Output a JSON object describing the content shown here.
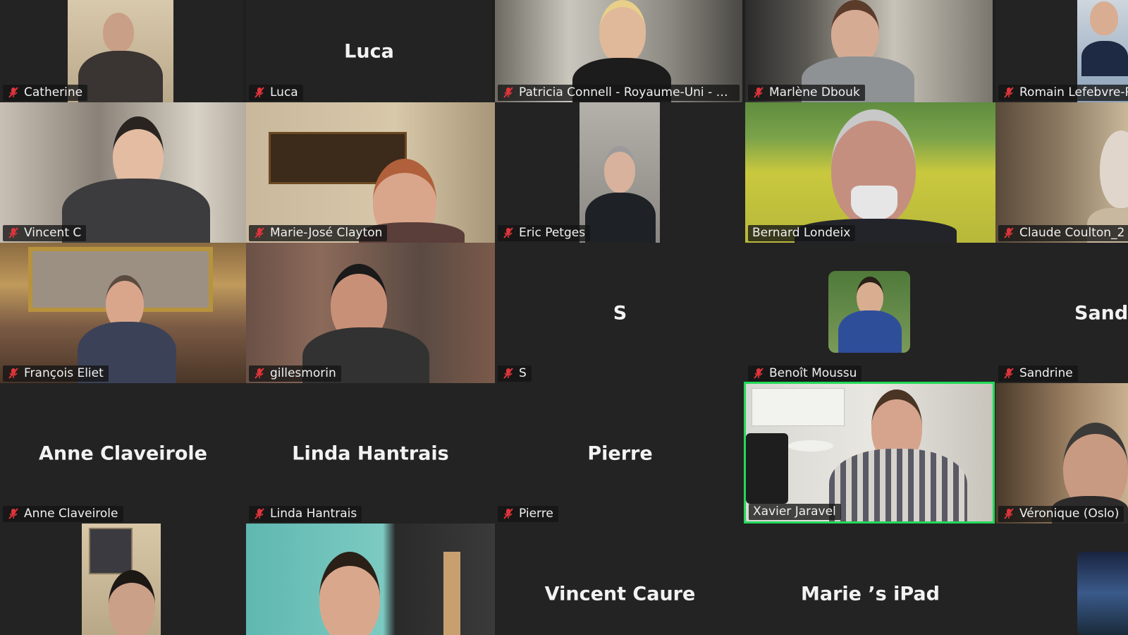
{
  "app": "Video conference — gallery view",
  "participants": [
    {
      "name": "Catherine",
      "center": "",
      "muted": true,
      "video": true,
      "active": false
    },
    {
      "name": "Luca",
      "center": "Luca",
      "muted": true,
      "video": false,
      "active": false
    },
    {
      "name": "Patricia Connell  - Royaume-Uni - Co...",
      "center": "",
      "muted": true,
      "video": true,
      "active": false
    },
    {
      "name": "Marlène Dbouk",
      "center": "",
      "muted": true,
      "video": true,
      "active": false
    },
    {
      "name": "Romain Lefebvre-R",
      "center": "",
      "muted": true,
      "video": true,
      "active": false
    },
    {
      "name": "Vincent C",
      "center": "",
      "muted": true,
      "video": true,
      "active": false
    },
    {
      "name": "Marie-José Clayton",
      "center": "",
      "muted": true,
      "video": true,
      "active": false
    },
    {
      "name": "Eric Petges",
      "center": "",
      "muted": true,
      "video": true,
      "active": false
    },
    {
      "name": "Bernard Londeix",
      "center": "",
      "muted": false,
      "video": true,
      "active": false
    },
    {
      "name": "Claude Coulton_2",
      "center": "",
      "muted": true,
      "video": true,
      "active": false
    },
    {
      "name": "François Eliet",
      "center": "",
      "muted": true,
      "video": true,
      "active": false
    },
    {
      "name": "gillesmorin",
      "center": "",
      "muted": true,
      "video": true,
      "active": false
    },
    {
      "name": "S",
      "center": "S",
      "muted": true,
      "video": false,
      "active": false
    },
    {
      "name": "Benoît Moussu",
      "center": "",
      "muted": true,
      "video": false,
      "active": false
    },
    {
      "name": "Sandrine",
      "center": "Sandr",
      "muted": true,
      "video": false,
      "active": false
    },
    {
      "name": "Anne Claveirole",
      "center": "Anne Claveirole",
      "muted": true,
      "video": false,
      "active": false
    },
    {
      "name": "Linda Hantrais",
      "center": "Linda Hantrais",
      "muted": true,
      "video": false,
      "active": false
    },
    {
      "name": "Pierre",
      "center": "Pierre",
      "muted": true,
      "video": false,
      "active": false
    },
    {
      "name": "Xavier Jaravel",
      "center": "",
      "muted": false,
      "video": true,
      "active": true
    },
    {
      "name": "Véronique (Oslo)",
      "center": "",
      "muted": true,
      "video": true,
      "active": false
    },
    {
      "name": "",
      "center": "",
      "muted": false,
      "video": true,
      "active": false
    },
    {
      "name": "",
      "center": "",
      "muted": false,
      "video": true,
      "active": false
    },
    {
      "name": "",
      "center": "Vincent Caure",
      "muted": false,
      "video": false,
      "active": false
    },
    {
      "name": "",
      "center": "Marie ’s iPad",
      "muted": false,
      "video": false,
      "active": false
    },
    {
      "name": "",
      "center": "",
      "muted": false,
      "video": true,
      "active": false
    }
  ],
  "colors": {
    "active_border": "#23d959",
    "mute_icon": "#e0343a",
    "tile_bg": "#232323"
  }
}
